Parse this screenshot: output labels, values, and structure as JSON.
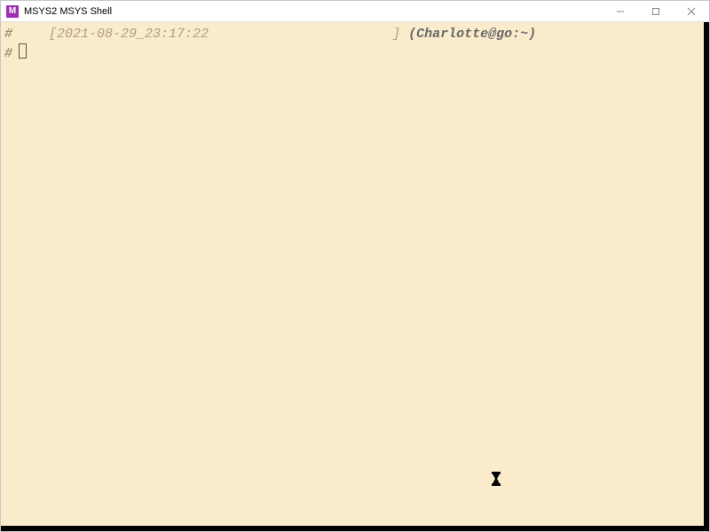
{
  "window": {
    "title": "MSYS2 MSYS Shell",
    "icon_letter": "M"
  },
  "prompt": {
    "hash": "#",
    "open_bracket": "[",
    "timestamp": "2021-08-29_23:17:22",
    "close_bracket": "]",
    "userhost": "(Charlotte@go:~)"
  },
  "hourglass_glyph": "⌛"
}
